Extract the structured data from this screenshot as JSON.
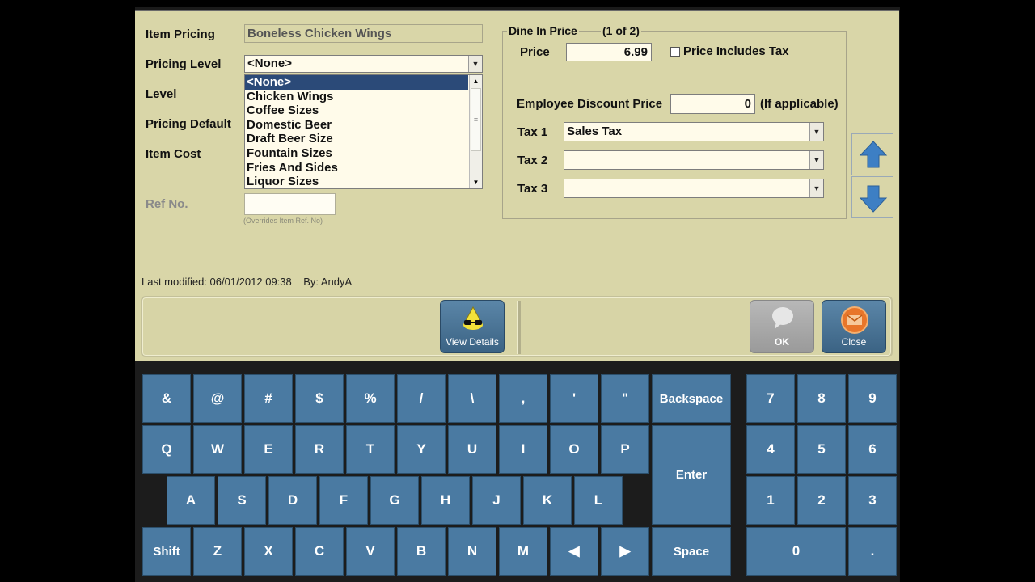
{
  "form": {
    "item_pricing_label": "Item Pricing",
    "item_pricing_value": "Boneless Chicken Wings",
    "pricing_level_label": "Pricing Level",
    "pricing_level_value": "<None>",
    "level_label": "Level",
    "pricing_default_label": "Pricing Default",
    "item_cost_label": "Item Cost",
    "ref_no_label": "Ref No.",
    "ref_no_value": "",
    "ref_no_hint": "(Overrides Item Ref. No)",
    "dropdown_options": [
      "<None>",
      "Chicken Wings",
      "Coffee Sizes",
      "Domestic Beer",
      "Draft Beer Size",
      "Fountain Sizes",
      "Fries And Sides",
      "Liquor Sizes"
    ],
    "last_modified": "Last modified: 06/01/2012 09:38    By: AndyA"
  },
  "price_group": {
    "title": "Dine In Price",
    "counter": "(1 of 2)",
    "price_label": "Price",
    "price_value": "6.99",
    "includes_tax_label": "Price Includes Tax",
    "includes_tax_checked": false,
    "employee_discount_label": "Employee Discount Price",
    "employee_discount_value": "0",
    "if_applicable": "(If applicable)",
    "tax1_label": "Tax 1",
    "tax1_value": "Sales Tax",
    "tax2_label": "Tax 2",
    "tax2_value": "",
    "tax3_label": "Tax 3",
    "tax3_value": ""
  },
  "nav": {
    "up_icon": "arrow-up-icon",
    "down_icon": "arrow-down-icon"
  },
  "toolbar": {
    "view_details_label": "View Details",
    "ok_label": "OK",
    "close_label": "Close"
  },
  "keyboard": {
    "row1": [
      "&",
      "@",
      "#",
      "$",
      "%",
      "/",
      "\\",
      ",",
      "'",
      "\""
    ],
    "row2": [
      "Q",
      "W",
      "E",
      "R",
      "T",
      "Y",
      "U",
      "I",
      "O",
      "P"
    ],
    "row3": [
      "A",
      "S",
      "D",
      "F",
      "G",
      "H",
      "J",
      "K",
      "L"
    ],
    "row4": [
      "Z",
      "X",
      "C",
      "V",
      "B",
      "N",
      "M",
      "◀",
      "▶"
    ],
    "backspace": "Backspace",
    "enter": "Enter",
    "shift": "Shift",
    "space": "Space",
    "numpad": [
      "7",
      "8",
      "9",
      "4",
      "5",
      "6",
      "1",
      "2",
      "3"
    ],
    "zero": "0",
    "dot": "."
  },
  "colors": {
    "panel": "#d9d6a8",
    "key": "#4a7aa2",
    "selection": "#2b4a78"
  }
}
